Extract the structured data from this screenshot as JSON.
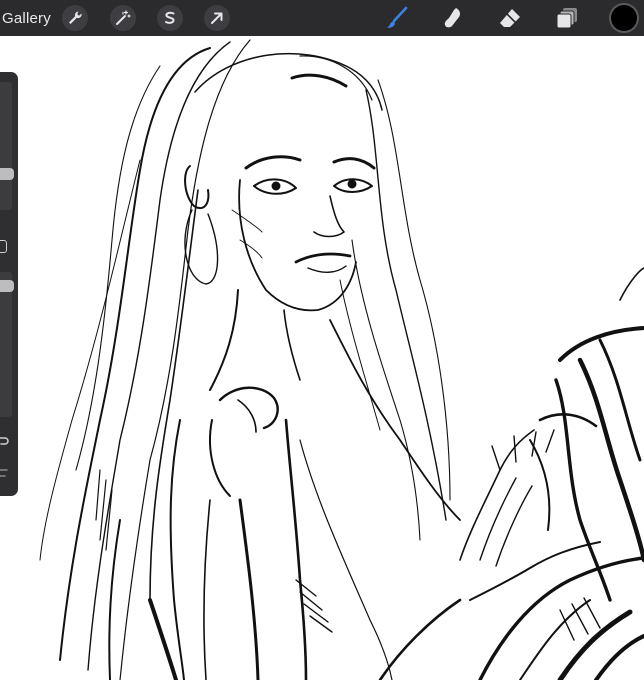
{
  "toolbar": {
    "gallery_label": "Gallery",
    "left_tools": [
      "wrench-icon",
      "magic-wand-icon",
      "selection-s-icon",
      "arrow-move-icon"
    ],
    "right_tools": [
      "brush-icon",
      "smudge-icon",
      "eraser-icon",
      "layers-icon"
    ],
    "active_tool": "brush-icon",
    "current_color": "#000000"
  },
  "sidebar": {
    "brush_size_level": 0.26,
    "opacity_level": 0.06
  },
  "colors": {
    "toolbar_bg": "#2b2b2d",
    "active_tool": "#3b82e6",
    "inactive_tool": "#e6e6e8",
    "canvas": "#ffffff"
  }
}
